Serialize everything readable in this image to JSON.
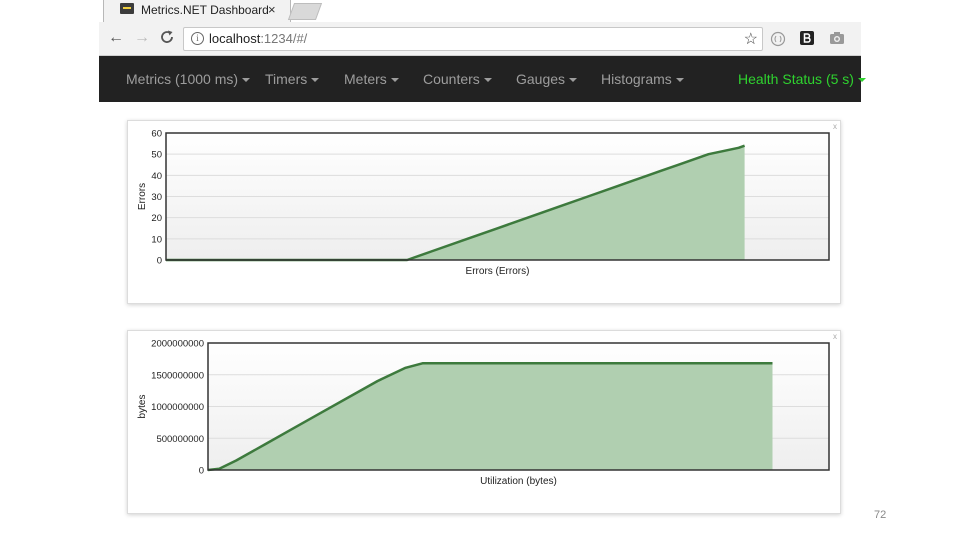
{
  "browser": {
    "tab_title": "Metrics.NET Dashboard",
    "tab_close": "×",
    "url_host": "localhost",
    "url_path": ":1234/#/",
    "back": "←",
    "forward": "→",
    "reload": "C",
    "info": "i",
    "star": "☆"
  },
  "navbar": {
    "items": [
      {
        "label": "Metrics (1000 ms)"
      },
      {
        "label": "Timers"
      },
      {
        "label": "Meters"
      },
      {
        "label": "Counters"
      },
      {
        "label": "Gauges"
      },
      {
        "label": "Histograms"
      }
    ],
    "health_label": "Health Status (5 s)",
    "health_color": "#2fd32f"
  },
  "panels": {
    "close_glyph": "x"
  },
  "slide_number": "72",
  "chart_data": [
    {
      "type": "area",
      "title": "",
      "xlabel": "Errors (Errors)",
      "ylabel": "Errors",
      "ylim": [
        0,
        60
      ],
      "yticks": [
        "0",
        "10",
        "20",
        "30",
        "40",
        "50",
        "60"
      ],
      "yvalues": [
        0,
        10,
        20,
        30,
        40,
        50,
        60
      ],
      "grid": true,
      "fill_color": "#b0cfb0",
      "line_color": "#3d7a3d",
      "series": [
        {
          "values": [
            [
              0,
              0
            ],
            [
              5,
              0
            ],
            [
              10,
              0
            ],
            [
              15,
              0
            ],
            [
              20,
              0
            ],
            [
              25,
              0
            ],
            [
              30,
              0
            ],
            [
              35,
              0
            ],
            [
              40,
              0
            ],
            [
              44,
              4
            ],
            [
              50,
              10
            ],
            [
              55,
              15
            ],
            [
              60,
              20
            ],
            [
              65,
              25
            ],
            [
              70,
              30
            ],
            [
              75,
              35
            ],
            [
              80,
              40
            ],
            [
              81,
              41
            ],
            [
              82,
              42
            ],
            [
              85,
              45
            ],
            [
              90,
              50
            ],
            [
              95,
              53
            ],
            [
              96,
              54
            ]
          ]
        }
      ]
    },
    {
      "type": "area",
      "title": "",
      "xlabel": "Utilization (bytes)",
      "ylabel": "bytes",
      "ylim": [
        0,
        2000000000
      ],
      "yticks": [
        "0",
        "500000000",
        "1000000000",
        "1500000000",
        "2000000000"
      ],
      "yvalues": [
        0,
        500000000,
        1000000000,
        1500000000,
        2000000000
      ],
      "grid": true,
      "fill_color": "#b0cfb0",
      "line_color": "#3d7a3d",
      "series": [
        {
          "values": [
            [
              0,
              0
            ],
            [
              2,
              20000000
            ],
            [
              5,
              150000000
            ],
            [
              10,
              400000000
            ],
            [
              15,
              650000000
            ],
            [
              20,
              900000000
            ],
            [
              25,
              1150000000
            ],
            [
              30,
              1400000000
            ],
            [
              35,
              1610000000
            ],
            [
              38,
              1680000000
            ],
            [
              45,
              1680000000
            ],
            [
              60,
              1680000000
            ],
            [
              75,
              1680000000
            ],
            [
              90,
              1680000000
            ],
            [
              100,
              1680000000
            ]
          ]
        }
      ]
    }
  ]
}
